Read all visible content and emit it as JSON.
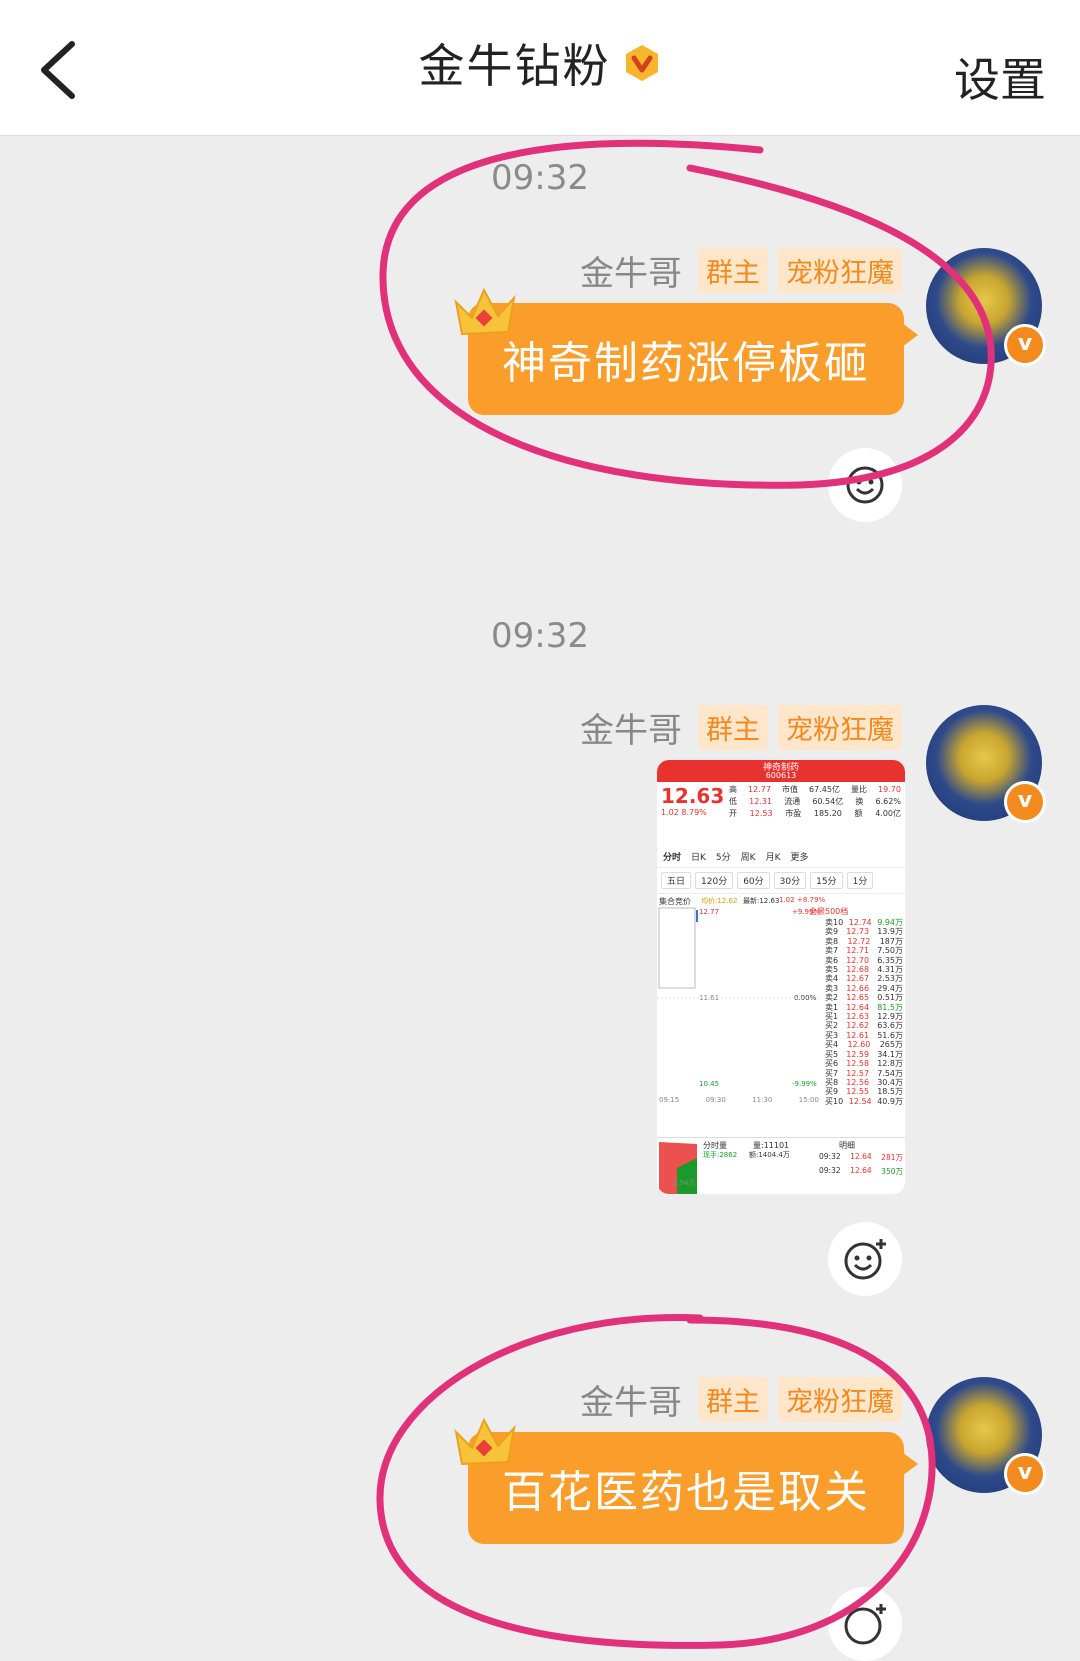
{
  "header": {
    "title": "金牛钻粉",
    "settings_label": "设置"
  },
  "messages": [
    {
      "time": "09:32",
      "sender": "金牛哥",
      "tags": [
        "群主",
        "宠粉狂魔"
      ],
      "text": "神奇制药涨停板砸"
    },
    {
      "time": "09:32",
      "sender": "金牛哥",
      "tags": [
        "群主",
        "宠粉狂魔"
      ],
      "image": {
        "stock_name": "神奇制药",
        "stock_code": "600613",
        "price": "12.63",
        "change": "1.02",
        "change_pct": "8.79%",
        "stats": [
          [
            "高",
            "12.77",
            "市值",
            "67.45亿",
            "量比",
            "19.70"
          ],
          [
            "低",
            "12.31",
            "流通",
            "60.54亿",
            "换",
            "6.62%"
          ],
          [
            "开",
            "12.53",
            "市盈",
            "185.20",
            "额",
            "4.00亿"
          ]
        ],
        "tabs": [
          "分时",
          "日K",
          "5分",
          "周K",
          "月K",
          "更多"
        ],
        "periods": [
          "五日",
          "120分",
          "60分",
          "30分",
          "15分",
          "1分"
        ],
        "chart_labels": {
          "auction": "集合竞价",
          "avg": "均价:12.62",
          "latest": "最新:12.63",
          "chg": "1.02",
          "pct": "+8.79%",
          "high": "12.77",
          "high_pct": "+9.99%",
          "mid": "11.61",
          "mid_pct": "0.00%",
          "low": "10.45",
          "low_pct": "-9.99%",
          "times": [
            "09:15",
            "09:30",
            "11:30",
            "15:00"
          ],
          "book_title": "全景500档"
        },
        "order_book": [
          [
            "卖10",
            "12.74",
            "9.94万"
          ],
          [
            "卖9",
            "12.73",
            "13.9万"
          ],
          [
            "卖8",
            "12.72",
            "187万"
          ],
          [
            "卖7",
            "12.71",
            "7.50万"
          ],
          [
            "卖6",
            "12.70",
            "6.35万"
          ],
          [
            "卖5",
            "12.68",
            "4.31万"
          ],
          [
            "卖4",
            "12.67",
            "2.53万"
          ],
          [
            "卖3",
            "12.66",
            "29.4万"
          ],
          [
            "卖2",
            "12.65",
            "0.51万"
          ],
          [
            "卖1",
            "12.64",
            "81.5万"
          ],
          [
            "买1",
            "12.63",
            "12.9万"
          ],
          [
            "买2",
            "12.62",
            "63.6万"
          ],
          [
            "买3",
            "12.61",
            "51.6万"
          ],
          [
            "买4",
            "12.60",
            "265万"
          ],
          [
            "买5",
            "12.59",
            "34.1万"
          ],
          [
            "买6",
            "12.58",
            "12.8万"
          ],
          [
            "买7",
            "12.57",
            "7.54万"
          ],
          [
            "买8",
            "12.56",
            "30.4万"
          ],
          [
            "买9",
            "12.55",
            "18.5万"
          ],
          [
            "买10",
            "12.54",
            "40.9万"
          ]
        ],
        "volume": {
          "label": "分时量",
          "vol": "量:11101",
          "now": "现手:2862",
          "amount": "额:1404.4万",
          "side": "5.94万",
          "detail_title": "明细",
          "trades": [
            [
              "09:32",
              "12.64",
              "281万"
            ],
            [
              "09:32",
              "12.64",
              "350万"
            ]
          ]
        }
      }
    },
    {
      "sender": "金牛哥",
      "tags": [
        "群主",
        "宠粉狂魔"
      ],
      "text": "百花医药也是取关"
    }
  ],
  "colors": {
    "bubble": "#fb9d2b",
    "tag_text": "#f28a1e",
    "tag_bg": "#fde6c9",
    "annotation": "#e0317a"
  }
}
